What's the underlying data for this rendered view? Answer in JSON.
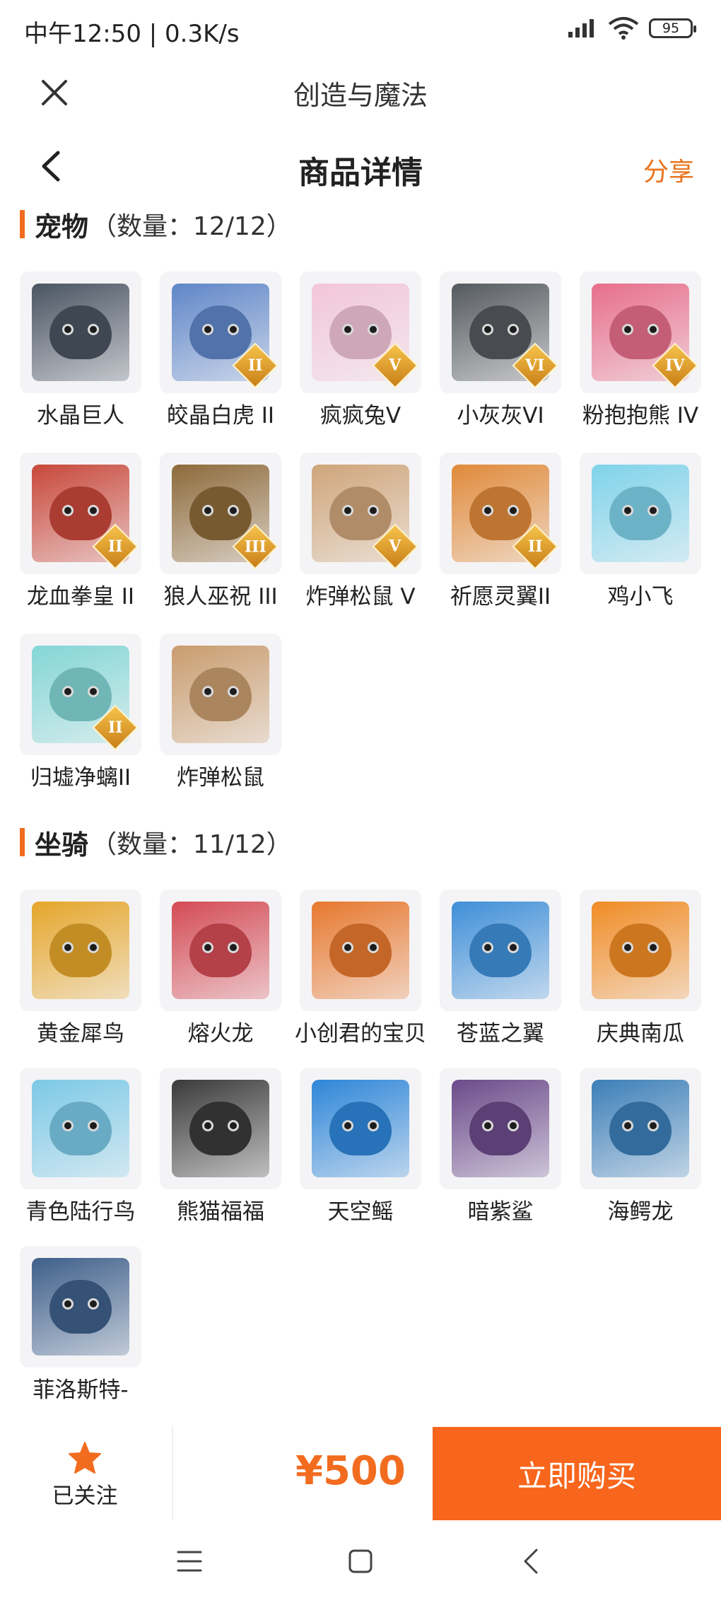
{
  "status": {
    "time": "中午12:50 | 0.3K/s",
    "battery": "95"
  },
  "app": {
    "title": "创造与魔法"
  },
  "header": {
    "title": "商品详情",
    "share": "分享"
  },
  "pets": {
    "name": "宠物",
    "count": "（数量：12/12）",
    "items": [
      {
        "label": "水晶巨人",
        "rank": "",
        "color": "#4a5462"
      },
      {
        "label": "皎晶白虎 II",
        "rank": "II",
        "color": "#5f86c8"
      },
      {
        "label": "疯疯兔V",
        "rank": "V",
        "color": "#f2c6d8"
      },
      {
        "label": "小灰灰VI",
        "rank": "VI",
        "color": "#555a5e"
      },
      {
        "label": "粉抱抱熊 IV",
        "rank": "IV",
        "color": "#e76e8b"
      },
      {
        "label": "龙血拳皇 II",
        "rank": "II",
        "color": "#c8473a"
      },
      {
        "label": "狼人巫祝 III",
        "rank": "III",
        "color": "#8d6a3a"
      },
      {
        "label": "炸弹松鼠 V",
        "rank": "V",
        "color": "#cfa57a"
      },
      {
        "label": "祈愿灵翼II",
        "rank": "II",
        "color": "#e08a3a"
      },
      {
        "label": "鸡小飞",
        "rank": "",
        "color": "#7fd3ea"
      },
      {
        "label": "归墟净螭II",
        "rank": "II",
        "color": "#84d6d6"
      },
      {
        "label": "炸弹松鼠",
        "rank": "",
        "color": "#c99c6e"
      }
    ]
  },
  "mounts": {
    "name": "坐骑",
    "count": "（数量：11/12）",
    "items": [
      {
        "label": "黄金犀鸟",
        "rank": "",
        "color": "#e5a62b"
      },
      {
        "label": "熔火龙",
        "rank": "",
        "color": "#d44b55"
      },
      {
        "label": "小创君的宝贝",
        "rank": "",
        "color": "#e7782e"
      },
      {
        "label": "苍蓝之翼",
        "rank": "",
        "color": "#3f8fd8"
      },
      {
        "label": "庆典南瓜",
        "rank": "",
        "color": "#f08c25"
      },
      {
        "label": "青色陆行鸟",
        "rank": "",
        "color": "#7cc9e6"
      },
      {
        "label": "熊猫福福",
        "rank": "",
        "color": "#3a3a3a"
      },
      {
        "label": "天空鳐",
        "rank": "",
        "color": "#2e86d8"
      },
      {
        "label": "暗紫鲨",
        "rank": "",
        "color": "#6b4a8a"
      },
      {
        "label": "海鳄龙",
        "rank": "",
        "color": "#3c7fb8"
      },
      {
        "label": "菲洛斯特-",
        "rank": "",
        "color": "#3e5f8a"
      }
    ]
  },
  "bottom": {
    "follow_label": "已关注",
    "price": "¥500",
    "buy_label": "立即购买"
  },
  "colors": {
    "accent": "#f26c1f",
    "buy": "#f7661c",
    "share": "#e9731c"
  }
}
